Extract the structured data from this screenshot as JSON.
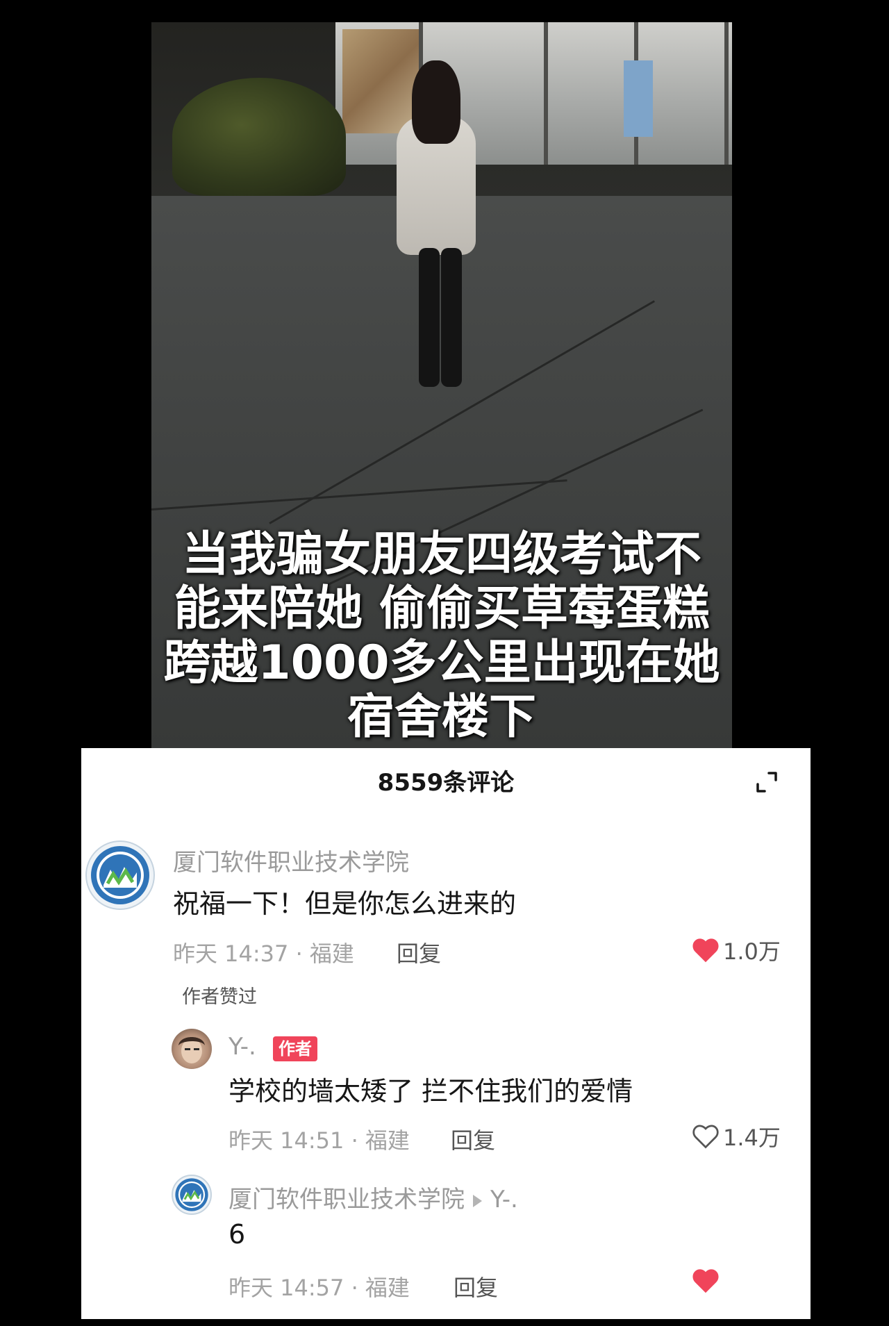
{
  "video": {
    "caption_lines": [
      "当我骗女朋友四级考试不",
      "能来陪她 偷偷买草莓蛋糕",
      "跨越1000多公里出现在她",
      "宿舍楼下"
    ]
  },
  "comments_panel": {
    "title": "8559条评论",
    "expand_icon": "expand-icon",
    "comments": [
      {
        "author": "厦门软件职业技术学院",
        "text": "祝福一下！但是你怎么进来的",
        "meta": "昨天 14:37 · 福建",
        "reply_label": "回复",
        "likes": "1.0万",
        "liked": true,
        "author_liked_label": "作者赞过"
      }
    ],
    "replies": [
      {
        "author": "Y-.",
        "badge": "作者",
        "text": "学校的墙太矮了 拦不住我们的爱情",
        "meta": "昨天 14:51 · 福建",
        "reply_label": "回复",
        "likes": "1.4万",
        "liked": false
      },
      {
        "author": "厦门软件职业技术学院",
        "reply_to": "Y-.",
        "text": "6",
        "meta": "昨天 14:57 · 福建",
        "reply_label": "回复",
        "likes": "",
        "liked": true
      }
    ]
  },
  "colors": {
    "like_red": "#f0445a",
    "background": "#000000",
    "panel": "#ffffff"
  }
}
